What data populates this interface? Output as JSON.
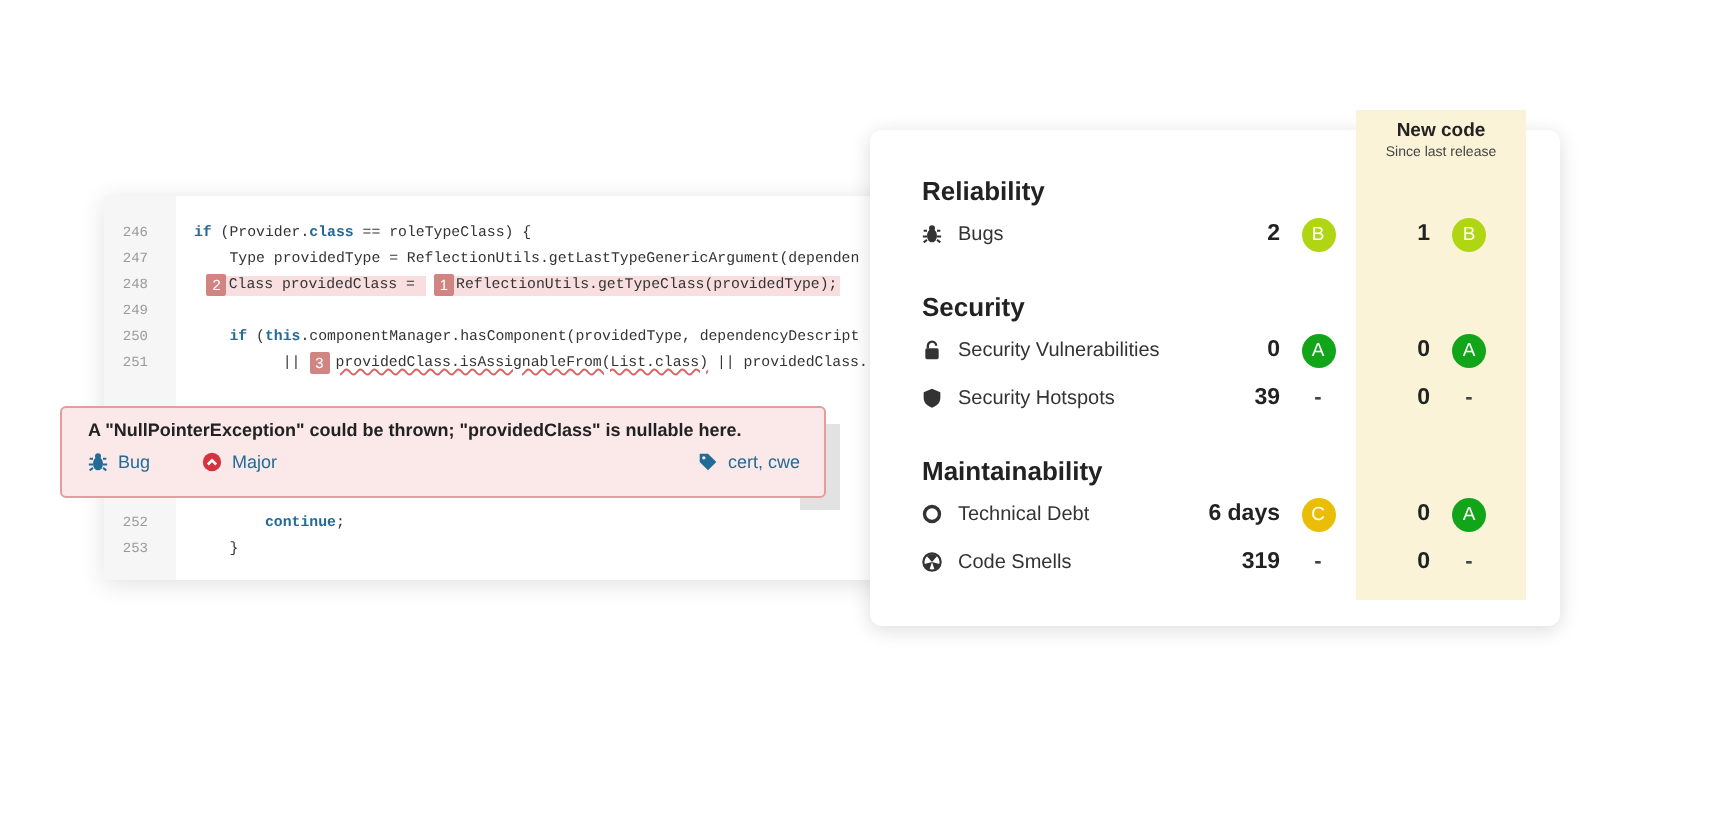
{
  "code": {
    "lines": [
      {
        "number": "246",
        "kind": "outer",
        "segments": [
          {
            "kind": "keyword",
            "text": "if"
          },
          {
            "kind": "code",
            "text": " (Provider."
          },
          {
            "kind": "keyword",
            "text": "class"
          },
          {
            "kind": "code",
            "text": " == roleTypeClass) {"
          }
        ]
      },
      {
        "number": "247",
        "kind": "inner",
        "segments": [
          {
            "kind": "code",
            "text": "Type providedType = ReflectionUtils.getLastTypeGenericArgument(dependen"
          }
        ]
      },
      {
        "number": "248",
        "kind": "marked",
        "segments": [
          {
            "kind": "marker",
            "text": "2"
          },
          {
            "kind": "flagged",
            "text": "Class providedClass = "
          },
          {
            "kind": "marker",
            "text": "1"
          },
          {
            "kind": "flagged",
            "text": "ReflectionUtils.getTypeClass(providedType);"
          }
        ]
      },
      {
        "number": "249",
        "kind": "outer"
      },
      {
        "number": "250",
        "kind": "inner",
        "segments": [
          {
            "kind": "keyword",
            "text": "if"
          },
          {
            "kind": "code",
            "text": " ("
          },
          {
            "kind": "keyword",
            "text": "this"
          },
          {
            "kind": "code",
            "text": ".componentManager.hasComponent(providedType, dependencyDescript"
          }
        ]
      },
      {
        "number": "251",
        "kind": "wrapped",
        "segments": [
          {
            "kind": "code",
            "text": "|| "
          },
          {
            "kind": "marker",
            "text": "3"
          },
          {
            "kind": "squiggle",
            "text": "providedClass.isAssignableFrom(List.class)"
          },
          {
            "kind": "code",
            "text": " || providedClass."
          }
        ]
      }
    ],
    "tail_lines": [
      {
        "number": "252",
        "kind": "body",
        "segments": [
          {
            "kind": "keyword",
            "text": "continue"
          },
          {
            "kind": "code",
            "text": ";"
          }
        ]
      },
      {
        "number": "253",
        "kind": "inner",
        "segments": [
          {
            "kind": "code",
            "text": "}"
          }
        ]
      }
    ]
  },
  "issue": {
    "message": "A \"NullPointerException\" could be thrown; \"providedClass\" is nullable here.",
    "type": "Bug",
    "severity": "Major",
    "tags": "cert, cwe"
  },
  "measures": {
    "new_code": {
      "title": "New code",
      "subtitle": "Since last release"
    },
    "sections": [
      {
        "title": "Reliability",
        "metrics": [
          {
            "kind": "bug",
            "label": "Bugs",
            "value": "2",
            "rating": {
              "label": "B",
              "color": "#b0d513"
            },
            "new_value": "1",
            "new_rating": {
              "label": "B",
              "color": "#b0d513"
            }
          }
        ]
      },
      {
        "title": "Security",
        "metrics": [
          {
            "kind": "vulnerability",
            "label": "Security Vulnerabilities",
            "value": "0",
            "rating": {
              "label": "A",
              "color": "#12a51a"
            },
            "new_value": "0",
            "new_rating": {
              "label": "A",
              "color": "#12a51a"
            }
          },
          {
            "kind": "hotspot",
            "label": "Security Hotspots",
            "value": "39",
            "rating": {
              "label": "-"
            },
            "new_value": "0",
            "new_rating": {
              "label": "-"
            }
          }
        ]
      },
      {
        "title": "Maintainability",
        "metrics": [
          {
            "kind": "debt",
            "label": "Technical Debt",
            "value": "6 days",
            "rating": {
              "label": "C",
              "color": "#eabe06"
            },
            "new_value": "0",
            "new_rating": {
              "label": "A",
              "color": "#12a51a"
            }
          },
          {
            "kind": "smell",
            "label": "Code Smells",
            "value": "319",
            "rating": {
              "label": "-"
            },
            "new_value": "0",
            "new_rating": {
              "label": "-"
            }
          }
        ]
      }
    ]
  }
}
